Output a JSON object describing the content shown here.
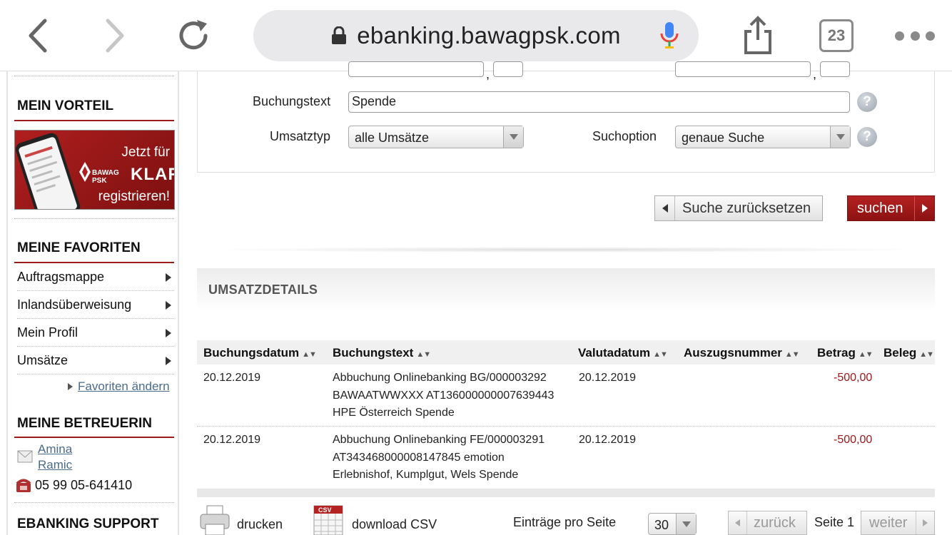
{
  "browser": {
    "url": "ebanking.bawagpsk.com",
    "tab_count": "23"
  },
  "sidebar": {
    "mein_vorteil_title": "MEIN VORTEIL",
    "banner": {
      "line1": "Jetzt für",
      "brand": "BAWAG PSK",
      "klar": "KLAR",
      "line2": "registrieren!"
    },
    "favoriten_title": "MEINE FAVORITEN",
    "favorites": [
      {
        "label": "Auftragsmappe"
      },
      {
        "label": "Inlandsüberweisung"
      },
      {
        "label": "Mein Profil"
      },
      {
        "label": "Umsätze"
      }
    ],
    "favoriten_aendern": "Favoriten ändern",
    "betreuerin_title": "MEINE BETREUERIN",
    "betreuerin_first": "Amina",
    "betreuerin_last": "Ramic",
    "phone": "05 99 05-641410",
    "support_title": "EBANKING SUPPORT"
  },
  "search_form": {
    "buchungstext_label": "Buchungstext",
    "buchungstext_value": "Spende",
    "umsatztyp_label": "Umsatztyp",
    "umsatztyp_value": "alle Umsätze",
    "suchoption_label": "Suchoption",
    "suchoption_value": "genaue Suche",
    "help_symbol": "?",
    "reset_label": "Suche zurücksetzen",
    "search_label": "suchen"
  },
  "details": {
    "title": "UMSATZDETAILS",
    "sort_symbol": "▲▼",
    "columns": [
      "Buchungsdatum",
      "Buchungstext",
      "Valutadatum",
      "Auszugsnummer",
      "Betrag",
      "Beleg"
    ],
    "rows": [
      {
        "buchungsdatum": "20.12.2019",
        "text1": "Abbuchung Onlinebanking BG/000003292",
        "text2": "BAWAATWWXXX AT136000000007639443",
        "text3": "HPE Österreich Spende",
        "valutadatum": "20.12.2019",
        "betrag": "-500,00"
      },
      {
        "buchungsdatum": "20.12.2019",
        "text1": "Abbuchung Onlinebanking FE/000003291",
        "text2": "AT343468000008147845 emotion",
        "text3": "Erlebnishof, Kumplgut, Wels Spende",
        "valutadatum": "20.12.2019",
        "betrag": "-500,00"
      }
    ]
  },
  "footer": {
    "drucken": "drucken",
    "csv_icon_text": "CSV",
    "download_csv": "download CSV",
    "eintraege_label": "Einträge pro Seite",
    "eintraege_value": "30",
    "zurueck": "zurück",
    "seite": "Seite 1",
    "weiter": "weiter"
  },
  "colors": {
    "brand_red": "#9b1b1b",
    "negative_amount": "#a01818",
    "link": "#4a6b8a"
  }
}
